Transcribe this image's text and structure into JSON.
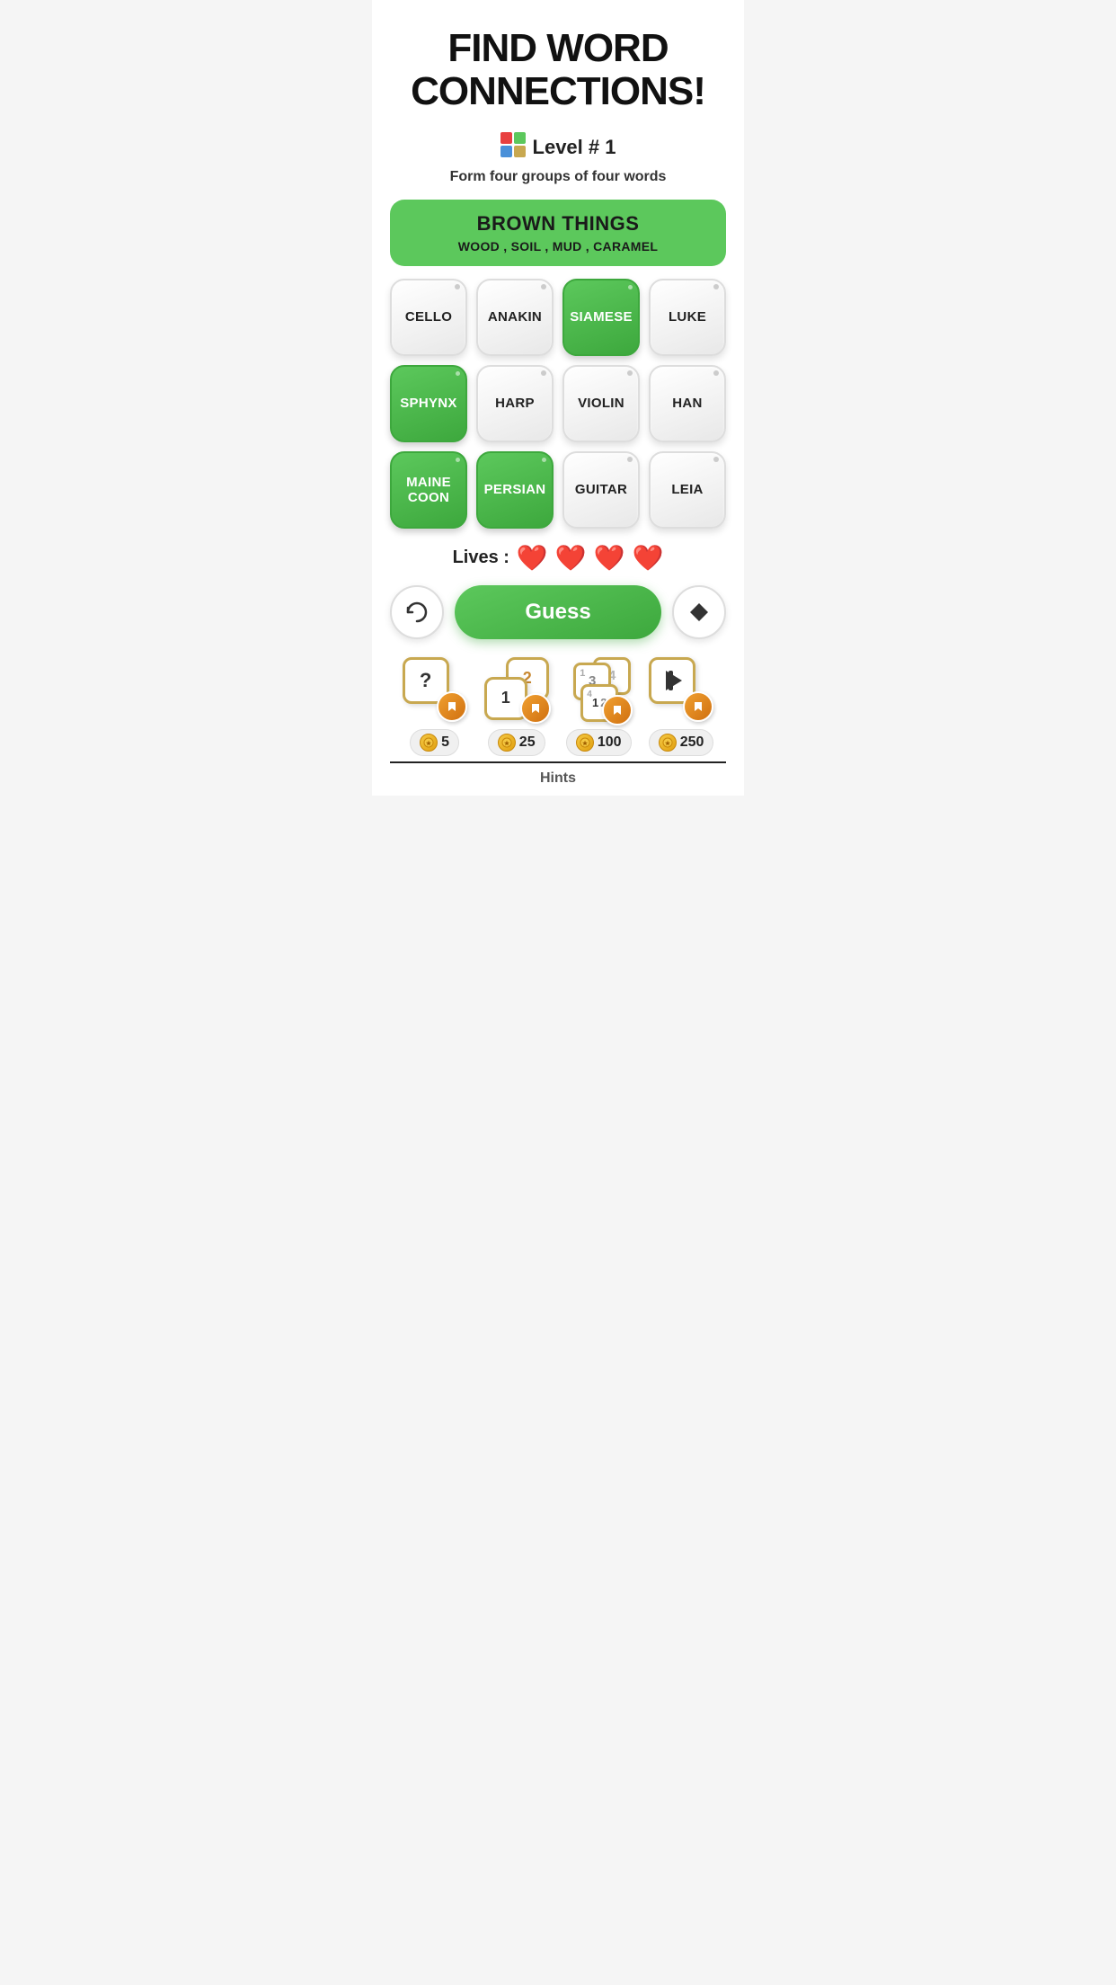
{
  "title": "FIND WORD CONNECTIONS!",
  "level": {
    "icon": "🎮",
    "text": "Level # 1"
  },
  "subtitle": "Form four groups of four words",
  "found_group": {
    "title": "BROWN THINGS",
    "words": "WOOD , SOIL , MUD , CARAMEL"
  },
  "tiles": [
    {
      "id": 0,
      "label": "CELLO",
      "selected": false
    },
    {
      "id": 1,
      "label": "ANAKIN",
      "selected": false
    },
    {
      "id": 2,
      "label": "SIAMESE",
      "selected": true
    },
    {
      "id": 3,
      "label": "LUKE",
      "selected": false
    },
    {
      "id": 4,
      "label": "SPHYNX",
      "selected": true
    },
    {
      "id": 5,
      "label": "HARP",
      "selected": false
    },
    {
      "id": 6,
      "label": "VIOLIN",
      "selected": false
    },
    {
      "id": 7,
      "label": "HAN",
      "selected": false
    },
    {
      "id": 8,
      "label": "MAINE COON",
      "selected": true
    },
    {
      "id": 9,
      "label": "PERSIAN",
      "selected": true
    },
    {
      "id": 10,
      "label": "GUITAR",
      "selected": false
    },
    {
      "id": 11,
      "label": "LEIA",
      "selected": false
    }
  ],
  "lives": {
    "label": "Lives :",
    "count": 4,
    "heart": "❤️"
  },
  "buttons": {
    "shuffle": "↻",
    "guess": "Guess",
    "erase": "◆"
  },
  "hints": [
    {
      "id": 0,
      "type": "question",
      "symbol": "?",
      "cost": "5"
    },
    {
      "id": 1,
      "type": "pair",
      "symbols": [
        "1",
        "2"
      ],
      "cost": "25"
    },
    {
      "id": 2,
      "type": "triple",
      "symbols": [
        "4",
        "3",
        "2",
        "1"
      ],
      "cost": "100"
    },
    {
      "id": 3,
      "type": "play",
      "cost": "250"
    }
  ],
  "hints_label": "Hints",
  "colors": {
    "green": "#5cc85c",
    "dark_green": "#3da83d",
    "red_heart": "#e84040",
    "tile_normal_bg": "#f0f0f0",
    "tile_selected_bg": "#5cc85c"
  }
}
